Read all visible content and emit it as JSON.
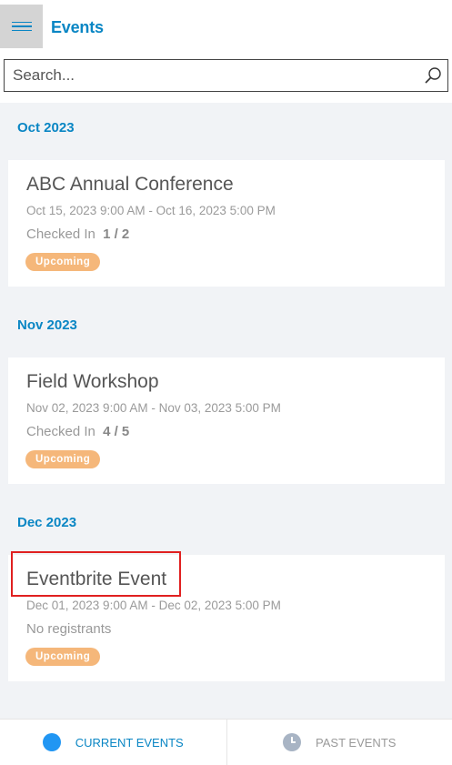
{
  "header": {
    "title": "Events",
    "menu_icon": "hamburger-menu-icon"
  },
  "search": {
    "placeholder": "Search...",
    "value": "",
    "icon": "search-icon"
  },
  "sections": [
    {
      "label": "Oct 2023",
      "events": [
        {
          "title": "ABC Annual Conference",
          "dates": "Oct 15, 2023 9:00 AM - Oct 16, 2023 5:00 PM",
          "checkin_label": "Checked In",
          "checkin_value": "1 / 2",
          "status": "Upcoming"
        }
      ]
    },
    {
      "label": "Nov 2023",
      "events": [
        {
          "title": "Field Workshop",
          "dates": "Nov 02, 2023 9:00 AM - Nov 03, 2023 5:00 PM",
          "checkin_label": "Checked In",
          "checkin_value": "4 / 5",
          "status": "Upcoming"
        }
      ]
    },
    {
      "label": "Dec 2023",
      "events": [
        {
          "title": "Eventbrite Event",
          "dates": "Dec 01, 2023 9:00 AM - Dec 02, 2023 5:00 PM",
          "registrants": "No registrants",
          "status": "Upcoming"
        }
      ]
    }
  ],
  "tabs": {
    "current": "CURRENT EVENTS",
    "past": "PAST EVENTS",
    "active": "current"
  },
  "colors": {
    "accent": "#0a86c4",
    "badge": "#f5b77a",
    "highlight": "#e02020"
  }
}
